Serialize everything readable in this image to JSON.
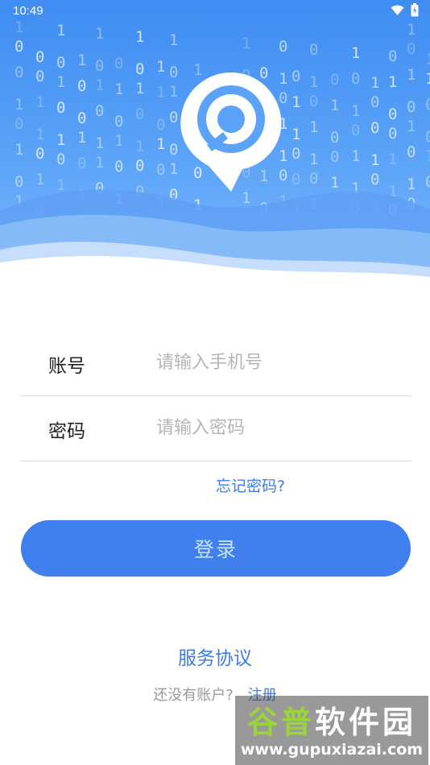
{
  "status_bar": {
    "time": "10:49"
  },
  "hero": {
    "binary_digits": [
      "1",
      "0",
      "0",
      "1",
      "0",
      "1",
      "0",
      "1",
      "0",
      "0",
      "1",
      "1",
      "0",
      "1",
      "0",
      "1",
      "0",
      "1",
      "0",
      "1",
      "0",
      "1",
      "1",
      "0",
      "0",
      "1",
      "0",
      "1",
      "1",
      "0",
      "1",
      "0",
      "1",
      "1",
      "0",
      "0",
      "1",
      "0",
      "1",
      "0",
      "1",
      "1",
      "0",
      "1",
      "0",
      "1",
      "0",
      "0",
      "1",
      "1",
      "0",
      "1",
      "0",
      "1",
      "1",
      "0"
    ]
  },
  "form": {
    "account": {
      "label": "账号",
      "placeholder": "请输入手机号",
      "value": ""
    },
    "password": {
      "label": "密码",
      "placeholder": "请输入密码",
      "value": ""
    },
    "forgot_password": "忘记密码?"
  },
  "login_button": "登录",
  "service_agreement": "服务协议",
  "register": {
    "prompt": "还没有账户?",
    "link": "注册"
  },
  "watermark": {
    "title_part1": "谷普",
    "title_part2": "软件园",
    "url": "www.gupuxiazai.com"
  },
  "colors": {
    "primary": "#3f80ee",
    "hero_top": "#3f8cf2",
    "link": "#3a7de8"
  }
}
